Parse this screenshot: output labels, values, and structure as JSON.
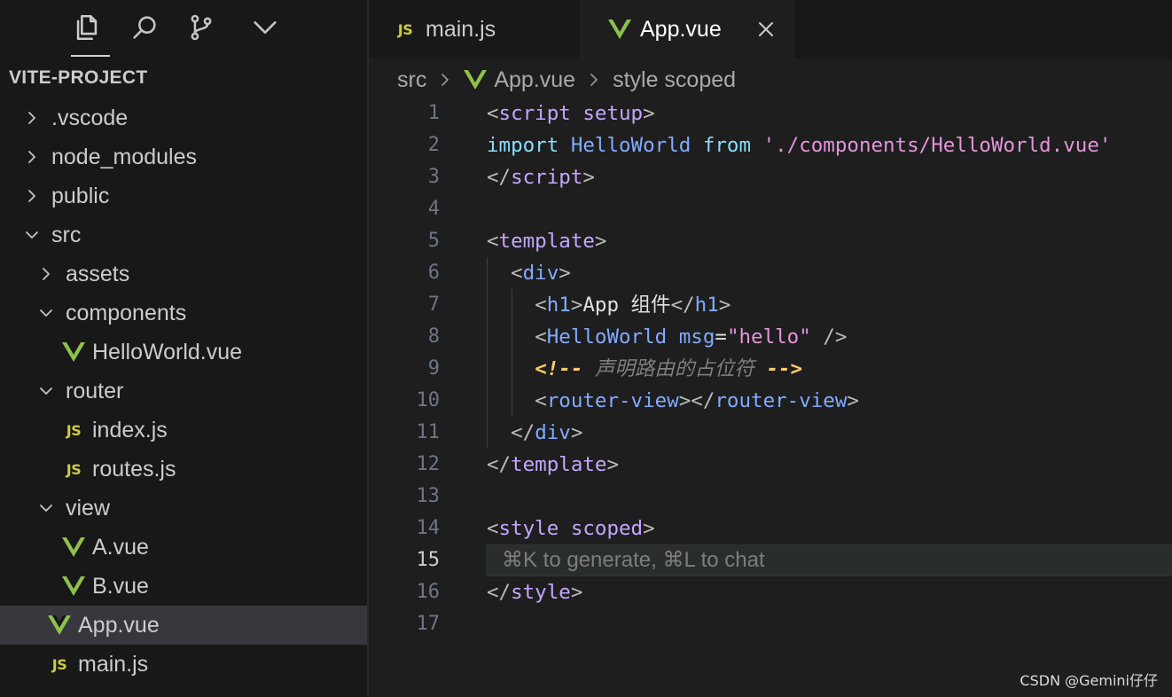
{
  "sidebar": {
    "title": "VITE-PROJECT",
    "tree": [
      {
        "label": ".vscode",
        "kind": "folder",
        "expanded": false,
        "depth": 0
      },
      {
        "label": "node_modules",
        "kind": "folder",
        "expanded": false,
        "depth": 0
      },
      {
        "label": "public",
        "kind": "folder",
        "expanded": false,
        "depth": 0
      },
      {
        "label": "src",
        "kind": "folder",
        "expanded": true,
        "depth": 0
      },
      {
        "label": "assets",
        "kind": "folder",
        "expanded": false,
        "depth": 1
      },
      {
        "label": "components",
        "kind": "folder",
        "expanded": true,
        "depth": 1
      },
      {
        "label": "HelloWorld.vue",
        "kind": "vue",
        "depth": 2
      },
      {
        "label": "router",
        "kind": "folder",
        "expanded": true,
        "depth": 1
      },
      {
        "label": "index.js",
        "kind": "js",
        "depth": 2
      },
      {
        "label": "routes.js",
        "kind": "js",
        "depth": 2
      },
      {
        "label": "view",
        "kind": "folder",
        "expanded": true,
        "depth": 1
      },
      {
        "label": "A.vue",
        "kind": "vue",
        "depth": 2
      },
      {
        "label": "B.vue",
        "kind": "vue",
        "depth": 2
      },
      {
        "label": "App.vue",
        "kind": "vue",
        "depth": 1,
        "selected": true
      },
      {
        "label": "main.js",
        "kind": "js",
        "depth": 1
      }
    ]
  },
  "icons": {
    "js_badge": "JS",
    "activity": [
      "explorer-icon",
      "search-icon",
      "source-control-icon",
      "chevron-down-icon"
    ]
  },
  "tabs": [
    {
      "label": "main.js",
      "kind": "js",
      "active": false
    },
    {
      "label": "App.vue",
      "kind": "vue",
      "active": true
    }
  ],
  "breadcrumb": {
    "folder": "src",
    "file": "App.vue",
    "symbol": "style scoped"
  },
  "editor": {
    "line_numbers": [
      "1",
      "2",
      "3",
      "4",
      "5",
      "6",
      "7",
      "8",
      "9",
      "10",
      "11",
      "12",
      "13",
      "14",
      "15",
      "16",
      "17"
    ],
    "current_line": "15",
    "inline_hint": "⌘K to generate, ⌘L to chat",
    "lines": [
      [
        [
          "t-br",
          "<"
        ],
        [
          "t-tag",
          "script"
        ],
        [
          "t-br",
          " "
        ],
        [
          "t-tag",
          "setup"
        ],
        [
          "t-br",
          ">"
        ]
      ],
      [
        [
          "t-kw",
          "import"
        ],
        [
          "t-text",
          " "
        ],
        [
          "t-id",
          "HelloWorld"
        ],
        [
          "t-text",
          " "
        ],
        [
          "t-kw",
          "from"
        ],
        [
          "t-text",
          " "
        ],
        [
          "t-str",
          "'./components/HelloWorld.vue'"
        ]
      ],
      [
        [
          "t-br",
          "</"
        ],
        [
          "t-tag",
          "script"
        ],
        [
          "t-br",
          ">"
        ]
      ],
      [],
      [
        [
          "t-br",
          "<"
        ],
        [
          "t-tag",
          "template"
        ],
        [
          "t-br",
          ">"
        ]
      ],
      [
        [
          "t-text",
          "  "
        ],
        [
          "t-br",
          "<"
        ],
        [
          "t-tag2",
          "div"
        ],
        [
          "t-br",
          ">"
        ]
      ],
      [
        [
          "t-text",
          "    "
        ],
        [
          "t-br",
          "<"
        ],
        [
          "t-tag2",
          "h1"
        ],
        [
          "t-br",
          ">"
        ],
        [
          "t-text",
          "App 组件"
        ],
        [
          "t-br",
          "</"
        ],
        [
          "t-tag2",
          "h1"
        ],
        [
          "t-br",
          ">"
        ]
      ],
      [
        [
          "t-text",
          "    "
        ],
        [
          "t-br",
          "<"
        ],
        [
          "t-tag2",
          "HelloWorld"
        ],
        [
          "t-text",
          " "
        ],
        [
          "t-attr",
          "msg"
        ],
        [
          "t-text",
          "="
        ],
        [
          "t-str",
          "\"hello\""
        ],
        [
          "t-text",
          " "
        ],
        [
          "t-br",
          "/>"
        ]
      ],
      [
        [
          "t-text",
          "    "
        ],
        [
          "t-cm-d",
          "<!--"
        ],
        [
          "t-cm",
          " 声明路由的占位符 "
        ],
        [
          "t-cm-d",
          "-->"
        ]
      ],
      [
        [
          "t-text",
          "    "
        ],
        [
          "t-br",
          "<"
        ],
        [
          "t-tag2",
          "router-view"
        ],
        [
          "t-br",
          "></"
        ],
        [
          "t-tag2",
          "router-view"
        ],
        [
          "t-br",
          ">"
        ]
      ],
      [
        [
          "t-text",
          "  "
        ],
        [
          "t-br",
          "</"
        ],
        [
          "t-tag2",
          "div"
        ],
        [
          "t-br",
          ">"
        ]
      ],
      [
        [
          "t-br",
          "</"
        ],
        [
          "t-tag",
          "template"
        ],
        [
          "t-br",
          ">"
        ]
      ],
      [],
      [
        [
          "t-br",
          "<"
        ],
        [
          "t-tag",
          "style"
        ],
        [
          "t-br",
          " "
        ],
        [
          "t-tag",
          "scoped"
        ],
        [
          "t-br",
          ">"
        ]
      ],
      [],
      [
        [
          "t-br",
          "</"
        ],
        [
          "t-tag",
          "style"
        ],
        [
          "t-br",
          ">"
        ]
      ],
      []
    ]
  },
  "watermark": "CSDN @Gemini仔仔",
  "colors": {
    "sidebar_bg": "#181818",
    "editor_bg": "#1e1e1e",
    "selected_row": "#37373d",
    "vue_green": "#8dc149",
    "js_yellow": "#cbcb41"
  }
}
